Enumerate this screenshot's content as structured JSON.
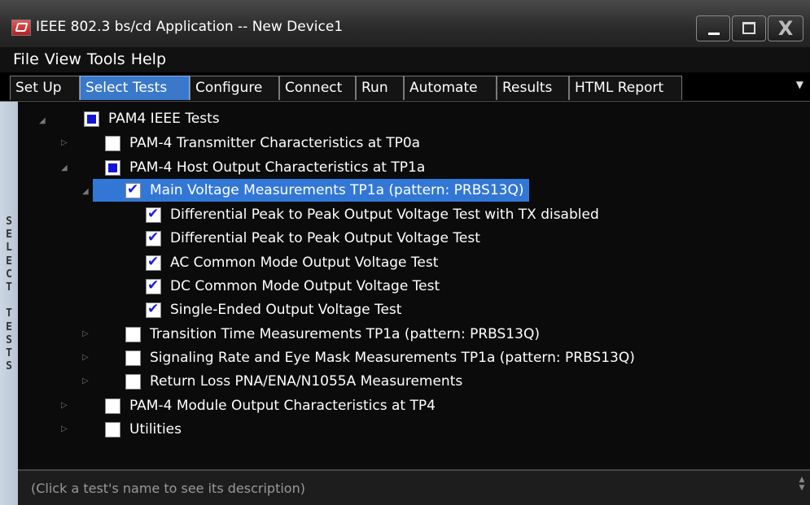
{
  "window": {
    "title": "IEEE 802.3 bs/cd Application -- New Device1",
    "close_symbol": "X"
  },
  "menu": [
    "File",
    "View",
    "Tools",
    "Help"
  ],
  "tabs": [
    "Set Up",
    "Select Tests",
    "Configure",
    "Connect",
    "Run",
    "Automate",
    "Results",
    "HTML Report"
  ],
  "active_tab": "Select Tests",
  "sidebar_label": "SELECT TESTS",
  "tree": [
    {
      "label": "PAM4 IEEE Tests",
      "state": "partial",
      "expander": "open"
    },
    {
      "label": "PAM-4 Transmitter Characteristics at TP0a",
      "state": "unchecked",
      "expander": "closed"
    },
    {
      "label": "PAM-4 Host Output Characteristics at TP1a",
      "state": "partial",
      "expander": "open"
    },
    {
      "label": "Main Voltage Measurements TP1a (pattern: PRBS13Q)",
      "state": "checked",
      "expander": "open",
      "selected": true
    },
    {
      "label": "Differential Peak to Peak Output Voltage Test with TX disabled",
      "state": "checked"
    },
    {
      "label": "Differential Peak to Peak Output Voltage Test",
      "state": "checked"
    },
    {
      "label": "AC Common Mode Output Voltage Test",
      "state": "checked"
    },
    {
      "label": "DC Common Mode Output Voltage Test",
      "state": "checked"
    },
    {
      "label": "Single-Ended Output Voltage Test",
      "state": "checked"
    },
    {
      "label": "Transition Time Measurements TP1a (pattern: PRBS13Q)",
      "state": "unchecked",
      "expander": "closed"
    },
    {
      "label": "Signaling Rate and Eye Mask Measurements TP1a (pattern: PRBS13Q)",
      "state": "unchecked",
      "expander": "closed"
    },
    {
      "label": "Return Loss PNA/ENA/N1055A Measurements",
      "state": "unchecked",
      "expander": "closed"
    },
    {
      "label": "PAM-4 Module Output Characteristics at TP4",
      "state": "unchecked",
      "expander": "closed"
    },
    {
      "label": "Utilities",
      "state": "unchecked",
      "expander": "closed"
    }
  ],
  "description": "(Click a test's name to see its description)"
}
